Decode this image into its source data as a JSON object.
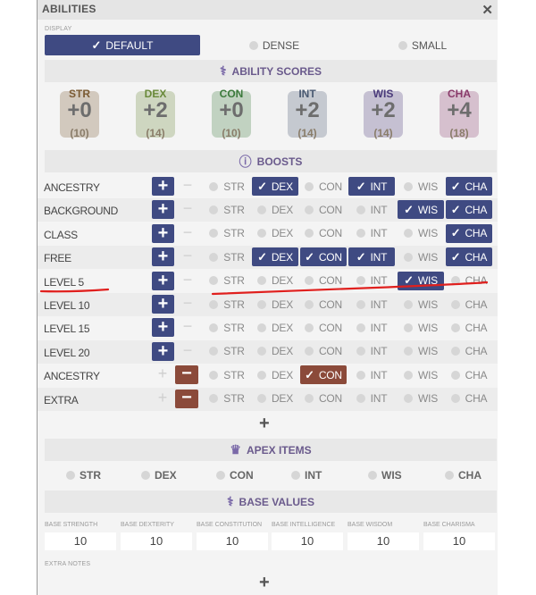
{
  "window": {
    "title": "ABILITIES",
    "close_glyph": "✕"
  },
  "display": {
    "label": "DISPLAY",
    "options": [
      {
        "label": "DEFAULT",
        "active": true
      },
      {
        "label": "DENSE",
        "active": false
      },
      {
        "label": "SMALL",
        "active": false
      }
    ]
  },
  "ability_scores": {
    "header": "ABILITY SCORES",
    "abilities": [
      {
        "name": "STR",
        "modifier": "+0",
        "score": "(10)",
        "color": "#7a5a32",
        "icon": "fist-icon"
      },
      {
        "name": "DEX",
        "modifier": "+2",
        "score": "(14)",
        "color": "#6a8a3a",
        "icon": "glove-icon"
      },
      {
        "name": "CON",
        "modifier": "+0",
        "score": "(10)",
        "color": "#3c7a3c",
        "icon": "armor-icon"
      },
      {
        "name": "INT",
        "modifier": "+2",
        "score": "(14)",
        "color": "#4a5a72",
        "icon": "book-icon"
      },
      {
        "name": "WIS",
        "modifier": "+2",
        "score": "(14)",
        "color": "#4a3a7a",
        "icon": "leaf-icon"
      },
      {
        "name": "CHA",
        "modifier": "+4",
        "score": "(18)",
        "color": "#8a3a6a",
        "icon": "sparkle-icon"
      }
    ]
  },
  "boosts": {
    "header": "BOOSTS",
    "ability_cols": [
      "STR",
      "DEX",
      "CON",
      "INT",
      "WIS",
      "CHA"
    ],
    "rows": [
      {
        "label": "ANCESTRY",
        "kind": "plus",
        "selected": [
          "DEX",
          "INT",
          "CHA"
        ],
        "flaw": []
      },
      {
        "label": "BACKGROUND",
        "kind": "plus",
        "selected": [
          "WIS",
          "CHA"
        ],
        "flaw": []
      },
      {
        "label": "CLASS",
        "kind": "plus",
        "selected": [
          "CHA"
        ],
        "flaw": []
      },
      {
        "label": "FREE",
        "kind": "plus",
        "selected": [
          "DEX",
          "CON",
          "INT",
          "CHA"
        ],
        "flaw": []
      },
      {
        "label": "LEVEL 5",
        "kind": "plus",
        "selected": [
          "WIS"
        ],
        "flaw": []
      },
      {
        "label": "LEVEL 10",
        "kind": "plus",
        "selected": [],
        "flaw": []
      },
      {
        "label": "LEVEL 15",
        "kind": "plus",
        "selected": [],
        "flaw": []
      },
      {
        "label": "LEVEL 20",
        "kind": "plus",
        "selected": [],
        "flaw": []
      },
      {
        "label": "ANCESTRY",
        "kind": "minus",
        "selected": [],
        "flaw": [
          "CON"
        ]
      },
      {
        "label": "EXTRA",
        "kind": "minus",
        "selected": [],
        "flaw": []
      }
    ],
    "add_glyph": "+"
  },
  "apex": {
    "header": "APEX ITEMS",
    "options": [
      "STR",
      "DEX",
      "CON",
      "INT",
      "WIS",
      "CHA"
    ]
  },
  "base_values": {
    "header": "BASE VALUES",
    "fields": [
      {
        "label": "BASE STRENGTH",
        "value": "10"
      },
      {
        "label": "BASE DEXTERITY",
        "value": "10"
      },
      {
        "label": "BASE CONSTITUTION",
        "value": "10"
      },
      {
        "label": "BASE INTELLIGENCE",
        "value": "10"
      },
      {
        "label": "BASE WISDOM",
        "value": "10"
      },
      {
        "label": "BASE CHARISMA",
        "value": "10"
      }
    ],
    "extra_notes_label": "EXTRA NOTES",
    "add_glyph": "+"
  },
  "colors": {
    "accent": "#3f4a82",
    "flaw": "#8b4a3a",
    "annotation": "#e0201e"
  }
}
